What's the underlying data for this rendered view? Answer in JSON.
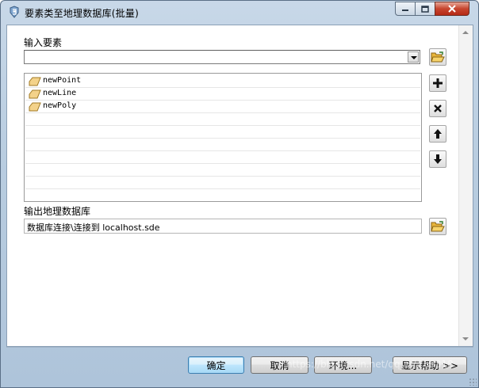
{
  "window": {
    "title": "要素类至地理数据库(批量)",
    "controls": {
      "minimize": "minimize-icon",
      "maximize": "maximize-icon",
      "close": "close-icon"
    }
  },
  "input_features": {
    "label": "输入要素",
    "combo_value": "",
    "items": [
      {
        "name": "newPoint",
        "icon": "feature-class-icon"
      },
      {
        "name": "newLine",
        "icon": "feature-class-icon"
      },
      {
        "name": "newPoly",
        "icon": "feature-class-icon"
      }
    ]
  },
  "side_buttons": {
    "browse": "folder-open-icon",
    "add": "plus-icon",
    "remove": "x-icon",
    "move_up": "arrow-up-icon",
    "move_down": "arrow-down-icon"
  },
  "output": {
    "label": "输出地理数据库",
    "value": "数据库连接\\连接到 localhost.sde"
  },
  "buttons": {
    "ok": "确定",
    "cancel": "取消",
    "env": "环境...",
    "help": "显示帮助 >>"
  },
  "watermark": "https://blog.csdn.net/qq_37268318",
  "colors": {
    "accent": "#3c7fb1",
    "close": "#c7452e",
    "folder": "#e8b53a",
    "feature_icon": "#f3d28a"
  }
}
